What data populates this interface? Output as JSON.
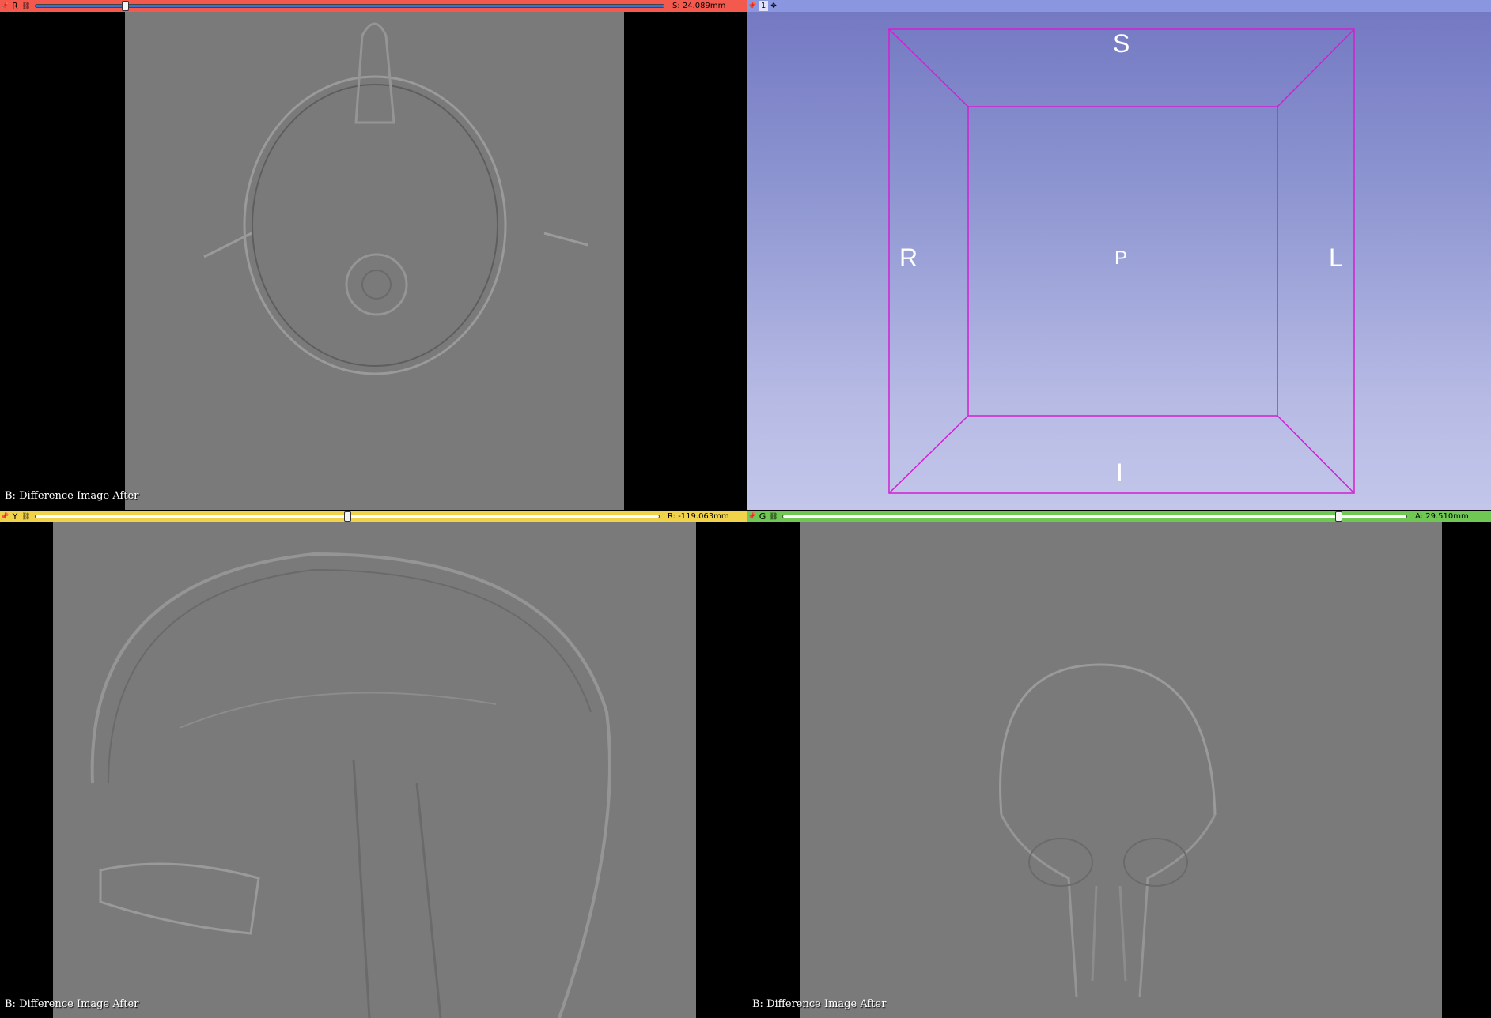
{
  "views": {
    "red": {
      "label": "R",
      "offset": "S: 24.089mm",
      "slider_fraction": 0.143,
      "annotation": "B: Difference Image After"
    },
    "three_d": {
      "label": "1"
    },
    "yellow": {
      "label": "Y",
      "offset": "R: -119.063mm",
      "slider_fraction": 0.5,
      "annotation": "B: Difference Image After"
    },
    "green": {
      "label": "G",
      "offset": "A: 29.510mm",
      "slider_fraction": 0.89,
      "annotation": "B: Difference Image After"
    }
  },
  "orientation": {
    "superior": "S",
    "inferior": "I",
    "right": "R",
    "left": "L",
    "posterior": "P"
  },
  "colors": {
    "red": "#f3594d",
    "yellow": "#f0d24b",
    "green": "#6fc854",
    "three_d": "#8a96e0",
    "box": "#d21fd2"
  },
  "icons": {
    "pin": "pin-icon",
    "link": "link-icon",
    "center": "center-icon"
  }
}
